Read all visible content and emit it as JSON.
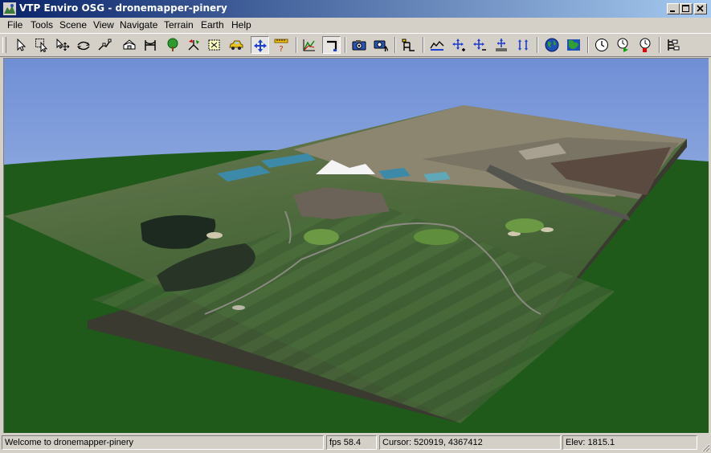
{
  "window": {
    "title": "VTP Enviro OSG - dronemapper-pinery"
  },
  "menu": [
    "File",
    "Tools",
    "Scene",
    "View",
    "Navigate",
    "Terrain",
    "Earth",
    "Help"
  ],
  "toolbar": {
    "buttons": [
      {
        "name": "select-tool-button",
        "icon": "arrow-pointer-icon"
      },
      {
        "name": "select-box-button",
        "icon": "select-box-icon"
      },
      {
        "name": "select-move-button",
        "icon": "select-move-icon"
      },
      {
        "name": "select-rotate-button",
        "icon": "rotate-arrows-icon"
      },
      {
        "name": "route-button",
        "icon": "route-line-icon"
      },
      {
        "name": "structure-button",
        "icon": "house-icon"
      },
      {
        "name": "fence-button",
        "icon": "fence-icon"
      },
      {
        "name": "plant-button",
        "icon": "tree-icon"
      },
      {
        "name": "instance-button",
        "icon": "instance-icon"
      },
      {
        "name": "vehicle-select-button",
        "icon": "dotted-box-icon"
      },
      {
        "name": "vehicle-button",
        "icon": "car-icon"
      },
      {
        "name": "navigate-move-button",
        "icon": "four-arrows-icon"
      },
      {
        "name": "measure-button",
        "icon": "ruler-question-icon"
      },
      {
        "name": "profile-button",
        "icon": "profile-graph-icon"
      },
      {
        "name": "scene-graph-button",
        "icon": "corner-icon"
      },
      {
        "name": "snapshot-button",
        "icon": "camera-icon"
      },
      {
        "name": "numbered-snapshot-button",
        "icon": "camera-n-icon"
      },
      {
        "name": "layers-button",
        "icon": "layers-icon"
      },
      {
        "name": "terrain-button",
        "icon": "terrain-graph-icon"
      },
      {
        "name": "ocean-plus-button",
        "icon": "arrows-plus-icon"
      },
      {
        "name": "ocean-minus-button",
        "icon": "arrows-minus-icon"
      },
      {
        "name": "height-button",
        "icon": "height-arrows-icon"
      },
      {
        "name": "spread-button",
        "icon": "spread-arrows-icon"
      },
      {
        "name": "globe-button",
        "icon": "globe-icon"
      },
      {
        "name": "map-button",
        "icon": "map-icon"
      },
      {
        "name": "time-button",
        "icon": "clock-icon"
      },
      {
        "name": "time-start-button",
        "icon": "clock-play-icon"
      },
      {
        "name": "time-stop-button",
        "icon": "clock-stop-icon"
      },
      {
        "name": "options-button",
        "icon": "options-icon"
      }
    ]
  },
  "statusbar": {
    "message": "Welcome to dronemapper-pinery",
    "fps": "fps 58.4",
    "cursor": "Cursor:  520919, 4367412",
    "elev": "Elev: 1815.1"
  },
  "colors": {
    "sky_top": "#6f8fd6",
    "sky_bottom": "#c9d8ef",
    "ground": "#1f5a1a",
    "title_start": "#0a246a",
    "title_end": "#a6caf0"
  }
}
